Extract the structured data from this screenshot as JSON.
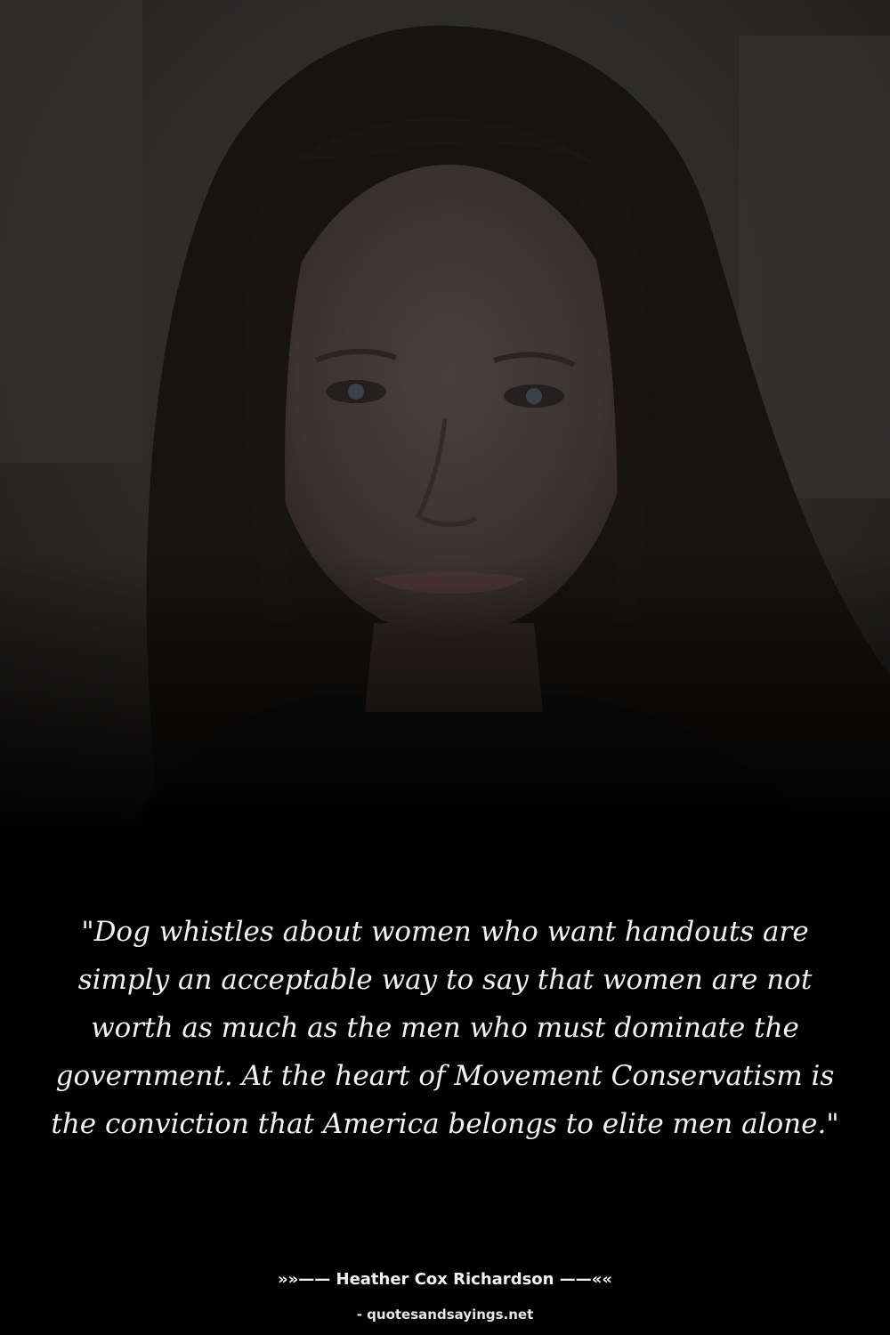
{
  "quote": {
    "text": "\"Dog whistles about women who want handouts are simply an acceptable way to say that women are not worth as much as the men who must dominate the government. At the heart of Movement Conservatism is the conviction that America belongs to elite men alone.\""
  },
  "author": {
    "line": "»»—— Heather Cox Richardson ——««"
  },
  "watermark": {
    "text": "- quotesandsayings.net"
  },
  "colors": {
    "background": "#000000",
    "text": "#f2f2f2"
  }
}
